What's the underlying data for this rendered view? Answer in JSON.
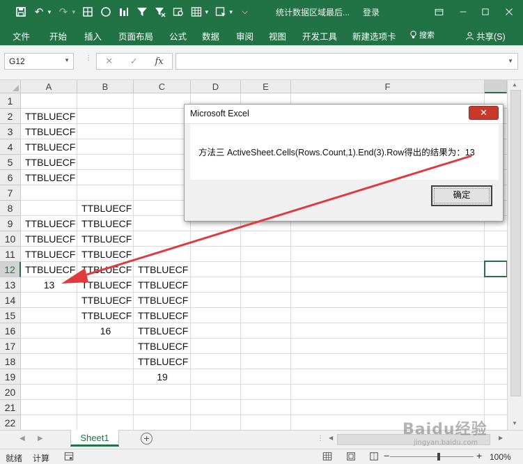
{
  "colors": {
    "accent": "#217346",
    "arrow": "#e03a3e",
    "close_red": "#c7392b"
  },
  "titlebar": {
    "doc_title": "统计数据区域最后...",
    "login": "登录",
    "qat_icons": [
      "save-icon",
      "undo-icon",
      "redo-icon",
      "grid-icon",
      "circle-icon",
      "chart-icon",
      "filter-icon",
      "clear-filter-icon",
      "camera-icon",
      "table-icon",
      "format-icon",
      "more-icon"
    ]
  },
  "ribbon": {
    "tabs": [
      "文件",
      "开始",
      "插入",
      "页面布局",
      "公式",
      "数据",
      "审阅",
      "视图",
      "开发工具",
      "新建选项卡"
    ],
    "search": "搜索",
    "share": "共享(S)"
  },
  "formula_bar": {
    "name_box": "G12",
    "fx": "fx",
    "content": ""
  },
  "sheet": {
    "columns": [
      "A",
      "B",
      "C",
      "D",
      "E",
      "F"
    ],
    "rows": [
      "1",
      "2",
      "3",
      "4",
      "5",
      "6",
      "7",
      "8",
      "9",
      "10",
      "11",
      "12",
      "13",
      "14",
      "15",
      "16",
      "17",
      "18",
      "19",
      "20",
      "21",
      "22"
    ],
    "cell_text": "TTBLUECF",
    "results": {
      "a": "13",
      "b": "16",
      "c": "19"
    }
  },
  "tabs": {
    "sheet1": "Sheet1",
    "add": "+"
  },
  "status": {
    "ready": "就绪",
    "calc": "计算",
    "zoom": "100%"
  },
  "dialog": {
    "title": "Microsoft Excel",
    "message": "方法三  ActiveSheet.Cells(Rows.Count,1).End(3).Row得出的结果为：13",
    "ok": "确定"
  },
  "watermark": {
    "brand": "Baidu经验",
    "url": "jingyan.baidu.com"
  }
}
